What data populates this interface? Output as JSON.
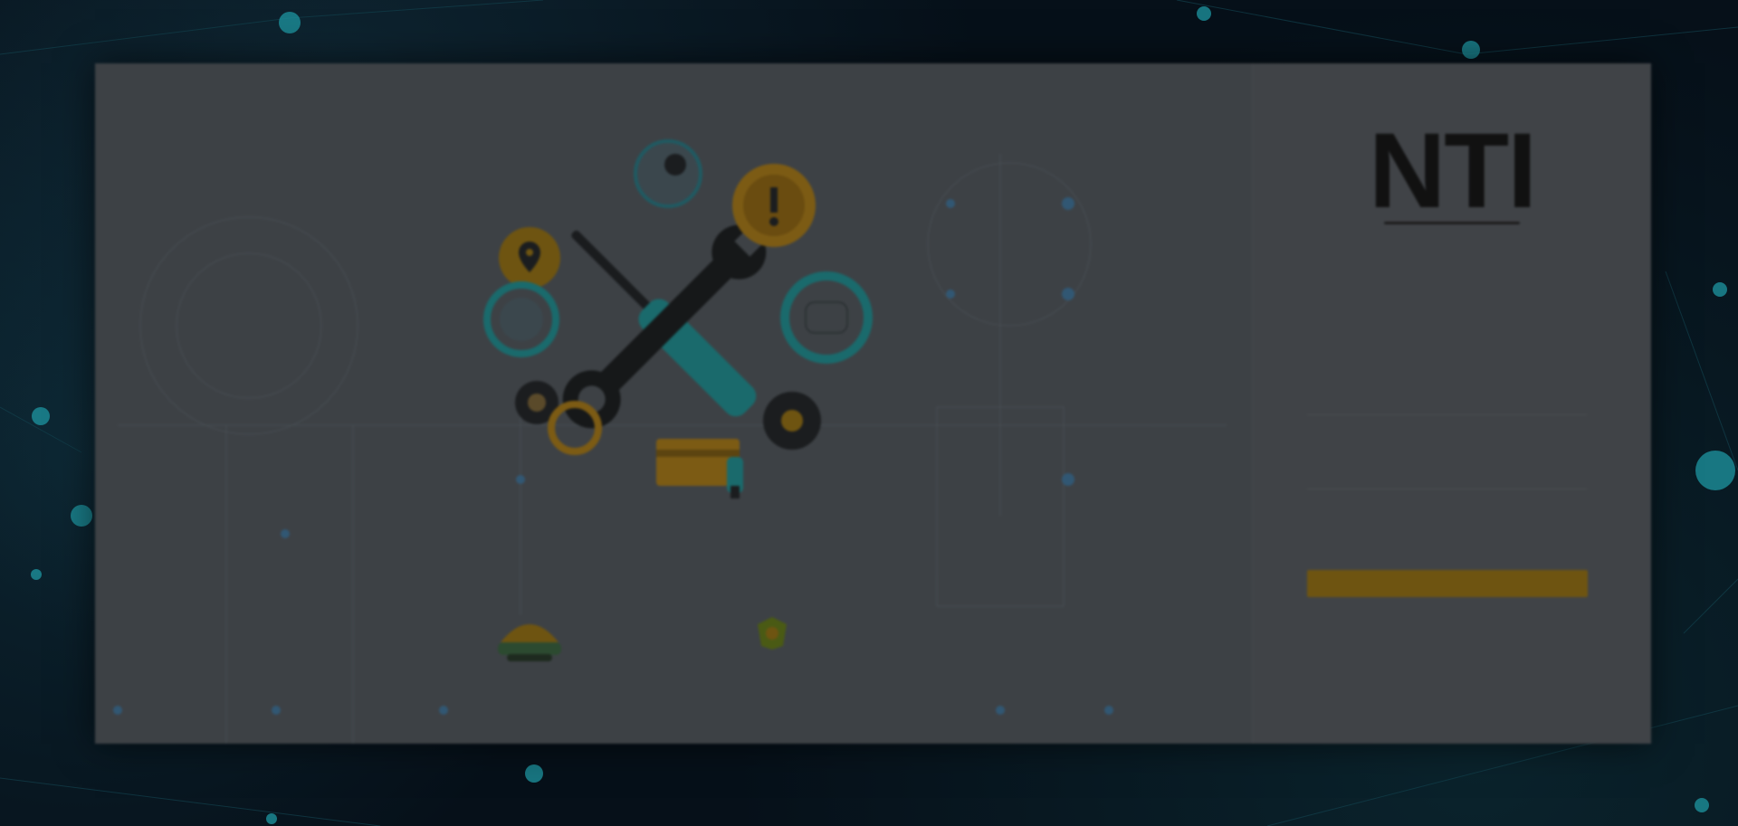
{
  "login": {
    "logo_text": "NTI",
    "tagline": "",
    "username_label": "",
    "username_value": "",
    "password_label": "",
    "password_value": "",
    "forgot_link": "",
    "login_button": ""
  },
  "partners": {
    "partner1_line1": "",
    "partner1_line2": "",
    "partner2_name": ""
  },
  "colors": {
    "accent": "#f0a500",
    "teal": "#1aa6a6",
    "card_bg": "#3d4145",
    "page_bg": "#061019"
  },
  "icons": {
    "center_illustration": "wrench-screwdriver-icon",
    "left_pin": "location-pin-icon",
    "top_circle": "globe-icon",
    "right_circle": "document-icon",
    "lower_left_circle": "chip-icon",
    "lower_right_circle": "mail-icon",
    "card": "credit-card-icon"
  }
}
